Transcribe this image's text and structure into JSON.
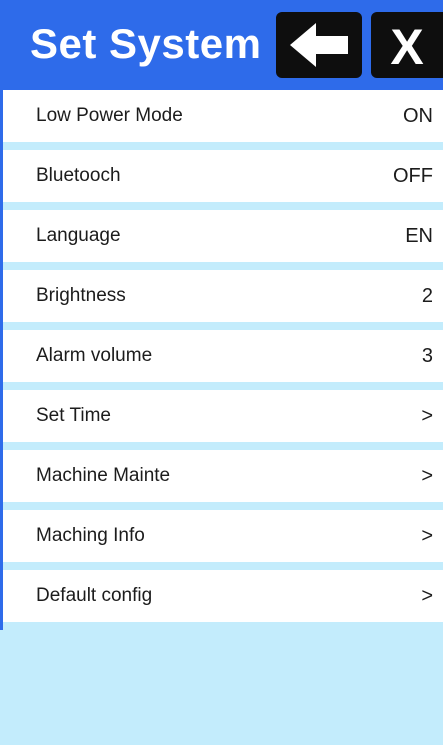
{
  "header": {
    "title": "Set System",
    "back_icon": "arrow-left-icon",
    "close_label": "X"
  },
  "colors": {
    "header_bg": "#2e6bea",
    "button_bg": "#0e0e0e",
    "panel_bg": "#c3ecfc",
    "row_bg": "#ffffff"
  },
  "settings": [
    {
      "label": "Low Power Mode",
      "value": "ON"
    },
    {
      "label": "Bluetooch",
      "value": "OFF"
    },
    {
      "label": "Language",
      "value": "EN"
    },
    {
      "label": "Brightness",
      "value": "2"
    },
    {
      "label": "Alarm volume",
      "value": "3"
    },
    {
      "label": "Set Time",
      "value": ">"
    },
    {
      "label": "Machine Mainte",
      "value": ">"
    },
    {
      "label": "Maching Info",
      "value": ">"
    },
    {
      "label": "Default config",
      "value": ">"
    }
  ]
}
